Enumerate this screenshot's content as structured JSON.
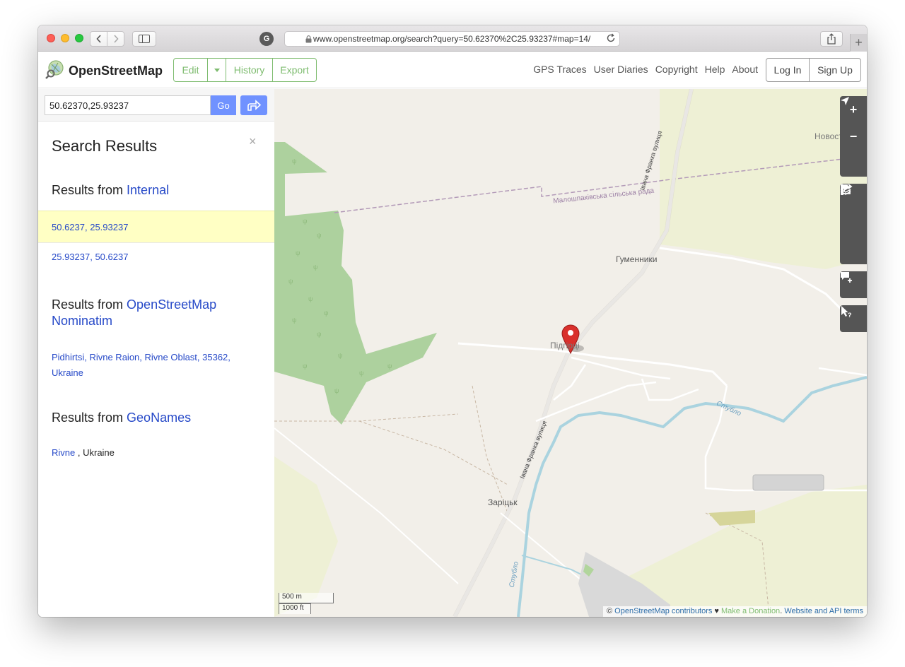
{
  "browser": {
    "url": "www.openstreetmap.org/search?query=50.62370%2C25.93237#map=14/",
    "ext_icon": "G",
    "new_tab": "+"
  },
  "header": {
    "brand": "OpenStreetMap",
    "edit": "Edit",
    "history": "History",
    "export": "Export",
    "links": [
      "GPS Traces",
      "User Diaries",
      "Copyright",
      "Help",
      "About"
    ],
    "login": "Log In",
    "signup": "Sign Up"
  },
  "search": {
    "query": "50.62370,25.93237",
    "go": "Go"
  },
  "results": {
    "title": "Search Results",
    "close": "×",
    "prefix": "Results from",
    "internal_source": "Internal",
    "internal_items": [
      "50.6237, 25.93237",
      "25.93237, 50.6237"
    ],
    "nominatim_source": "OpenStreetMap Nominatim",
    "nominatim_items": [
      "Pidhirtsi, Rivne Raion, Rivne Oblast, 35362, Ukraine"
    ],
    "geonames_source": "GeoNames",
    "geonames_link": "Rivne",
    "geonames_suffix": ", Ukraine"
  },
  "map": {
    "labels": {
      "council": "Малошпаківська сільська рада",
      "novostav": "Новостав-Да",
      "hymennyky": "Гуменники",
      "pidhirtsi": "Підгірці",
      "zaritsk": "Заріцьк",
      "street_north": "Івана Франка вулиця",
      "street_south": "Івана Франка вулиця",
      "river_east": "Стубло",
      "river_south": "Стубло"
    },
    "controls": {
      "zoom_in": "+",
      "zoom_out": "−"
    },
    "scale_metric": "500 m",
    "scale_imperial": "1000 ft",
    "attribution": {
      "copy": "©",
      "contributors": "OpenStreetMap contributors",
      "heart": " ♥ ",
      "donate": "Make a Donation",
      "dot": ". ",
      "terms": "Website and API terms"
    }
  },
  "colors": {
    "osm_green": "#7ebc6f",
    "link_blue": "#2649c8",
    "highlight": "#ffffc4",
    "forest": "#add19e",
    "river": "#aad3df",
    "marker": "#d9302c"
  }
}
